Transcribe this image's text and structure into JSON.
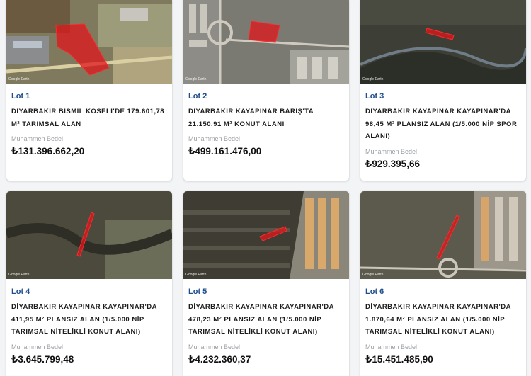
{
  "currency_icon": "turkish-lira-sign",
  "map_watermark": "Google Earth",
  "estimate_label": "Muhammen Bedel",
  "colors": {
    "lot_accent": "#1f4e8c",
    "parcel_highlight": "#e0161b"
  },
  "lots": [
    {
      "lot": "Lot 1",
      "title": "DİYARBAKIR BİSMİL KÖSELİ'DE 179.601,78 M² TARIMSAL ALAN",
      "price": "₺131.396.662,20"
    },
    {
      "lot": "Lot 2",
      "title": "DİYARBAKIR KAYAPINAR BARIŞ'TA 21.150,91 M² KONUT ALANI",
      "price": "₺499.161.476,00"
    },
    {
      "lot": "Lot 3",
      "title": "DİYARBAKIR KAYAPINAR KAYAPINAR'DA 98,45 M² PLANSIZ ALAN (1/5.000 NİP SPOR ALANI)",
      "price": "₺929.395,66"
    },
    {
      "lot": "Lot 4",
      "title": "DİYARBAKIR KAYAPINAR KAYAPINAR'DA 411,95 M² PLANSIZ ALAN (1/5.000 NİP TARIMSAL NİTELİKLİ KONUT ALANI)",
      "price": "₺3.645.799,48"
    },
    {
      "lot": "Lot 5",
      "title": "DİYARBAKIR KAYAPINAR KAYAPINAR'DA 478,23 M² PLANSIZ ALAN (1/5.000 NİP TARIMSAL NİTELİKLİ KONUT ALANI)",
      "price": "₺4.232.360,37"
    },
    {
      "lot": "Lot 6",
      "title": "DİYARBAKIR KAYAPINAR KAYAPINAR'DA 1.870,64 M² PLANSIZ ALAN (1/5.000 NİP TARIMSAL NİTELİKLİ KONUT ALANI)",
      "price": "₺15.451.485,90"
    }
  ]
}
